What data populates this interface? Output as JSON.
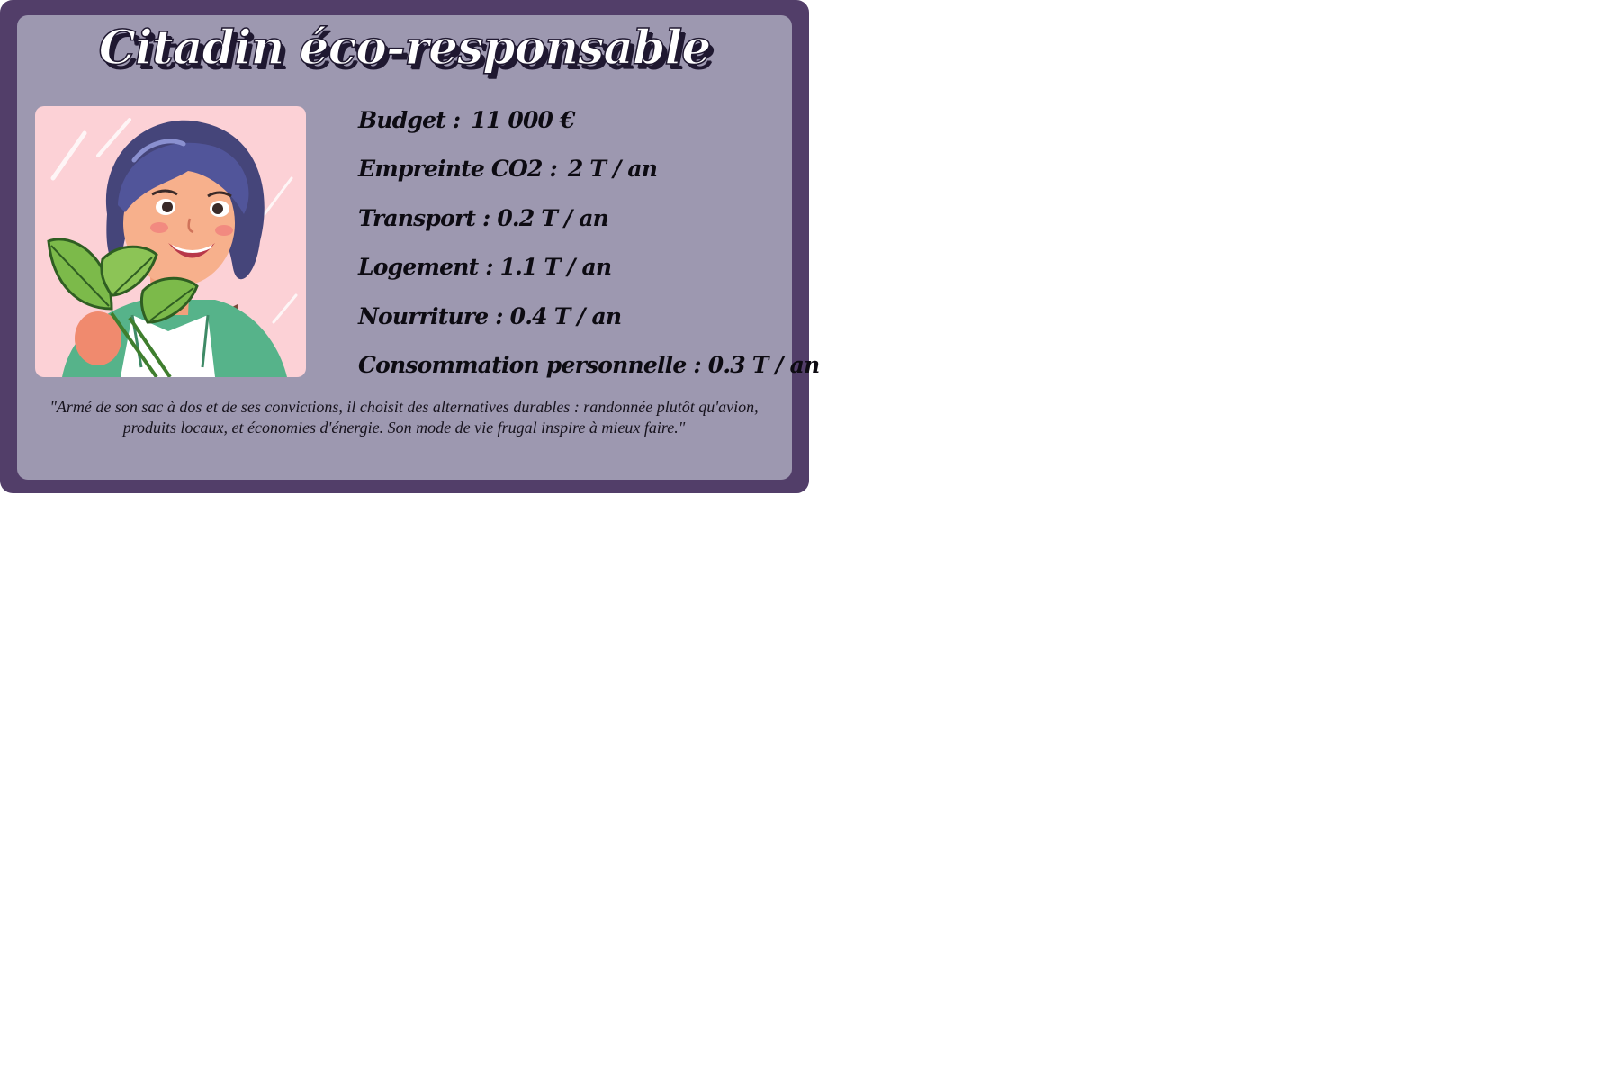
{
  "card": {
    "title": "Citadin éco-responsable",
    "portrait_alt": "Portrait illustration of a smiling young person in a green jacket holding a plant",
    "stats": [
      {
        "label": "Budget :",
        "value": "11 000 €"
      },
      {
        "label": "Empreinte CO2 :",
        "value": "2 T / an"
      },
      {
        "label": "Transport :",
        "value": "0.2 T / an"
      },
      {
        "label": "Logement :",
        "value": "1.1 T / an"
      },
      {
        "label": "Nourriture :",
        "value": "0.4 T / an"
      },
      {
        "label": "Consommation personnelle :",
        "value": "0.3 T / an"
      }
    ],
    "quote": "\"Armé de son sac à dos et de ses convictions, il choisit des alternatives durables : randonnée plutôt qu'avion, produits locaux, et économies d'énergie. Son mode de vie frugal inspire à mieux faire.\""
  },
  "colors": {
    "frame": "#523e69",
    "panel": "#9d98b0",
    "portrait_background": "#fcd1d6",
    "text": "#0d0b12"
  }
}
